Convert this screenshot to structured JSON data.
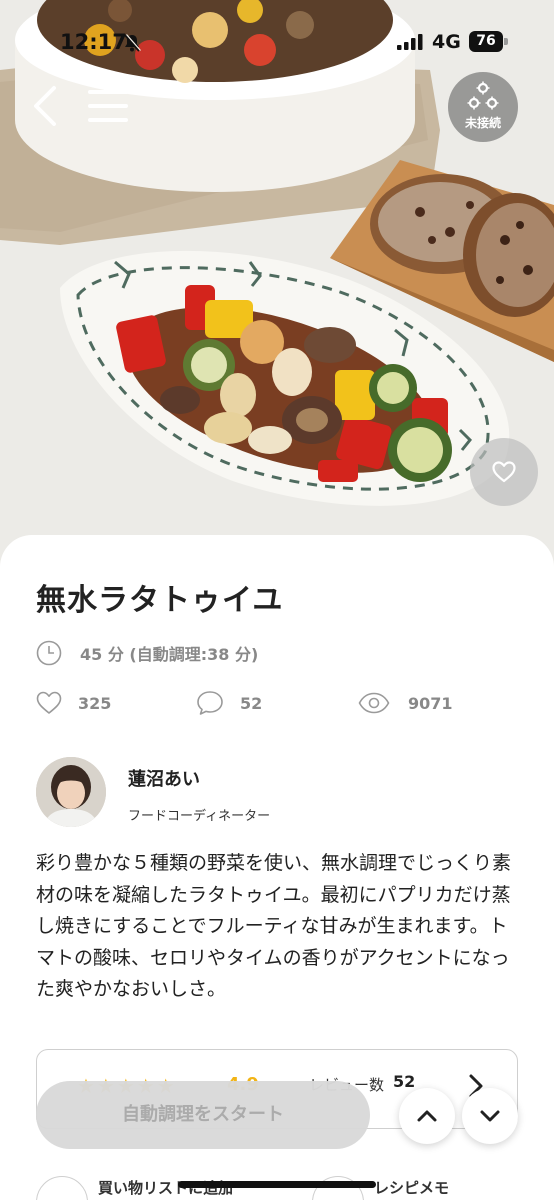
{
  "status_bar": {
    "time": "12:17",
    "network": "4G",
    "battery": "76"
  },
  "device": {
    "status_label": "未接続"
  },
  "recipe": {
    "title": "無水ラタトゥイユ",
    "cook_time": "45 分 (自動調理:38 分)",
    "likes": "325",
    "comments": "52",
    "views": "9071",
    "description": "彩り豊かな５種類の野菜を使い、無水調理でじっくり素材の味を凝縮したラタトゥイユ。最初にパプリカだけ蒸し焼きにすることでフルーティな甘みが生まれます。トマトの酸味、セロリやタイムの香りがアクセントになった爽やかなおいしさ。"
  },
  "author": {
    "name": "蓮沼あい",
    "role": "フードコーディネーター"
  },
  "reviews": {
    "stars": "★★★★★",
    "rating": "4.9",
    "label": "レビュー数",
    "count": "52"
  },
  "actions": {
    "start_label": "自動調理をスタート",
    "shopping_list_label": "買い物リストに追加",
    "memo_label": "レシピメモ"
  },
  "icons": [
    "bell-off-icon",
    "signal-icon",
    "battery-icon",
    "back-icon",
    "menu-icon",
    "device-icon",
    "heart-icon",
    "clock-icon",
    "comment-icon",
    "eye-icon",
    "chevron-right-icon",
    "chevron-up-icon",
    "chevron-down-icon"
  ],
  "colors": {
    "accent_star": "#f2b415",
    "disabled_button": "#d9d9d9"
  }
}
